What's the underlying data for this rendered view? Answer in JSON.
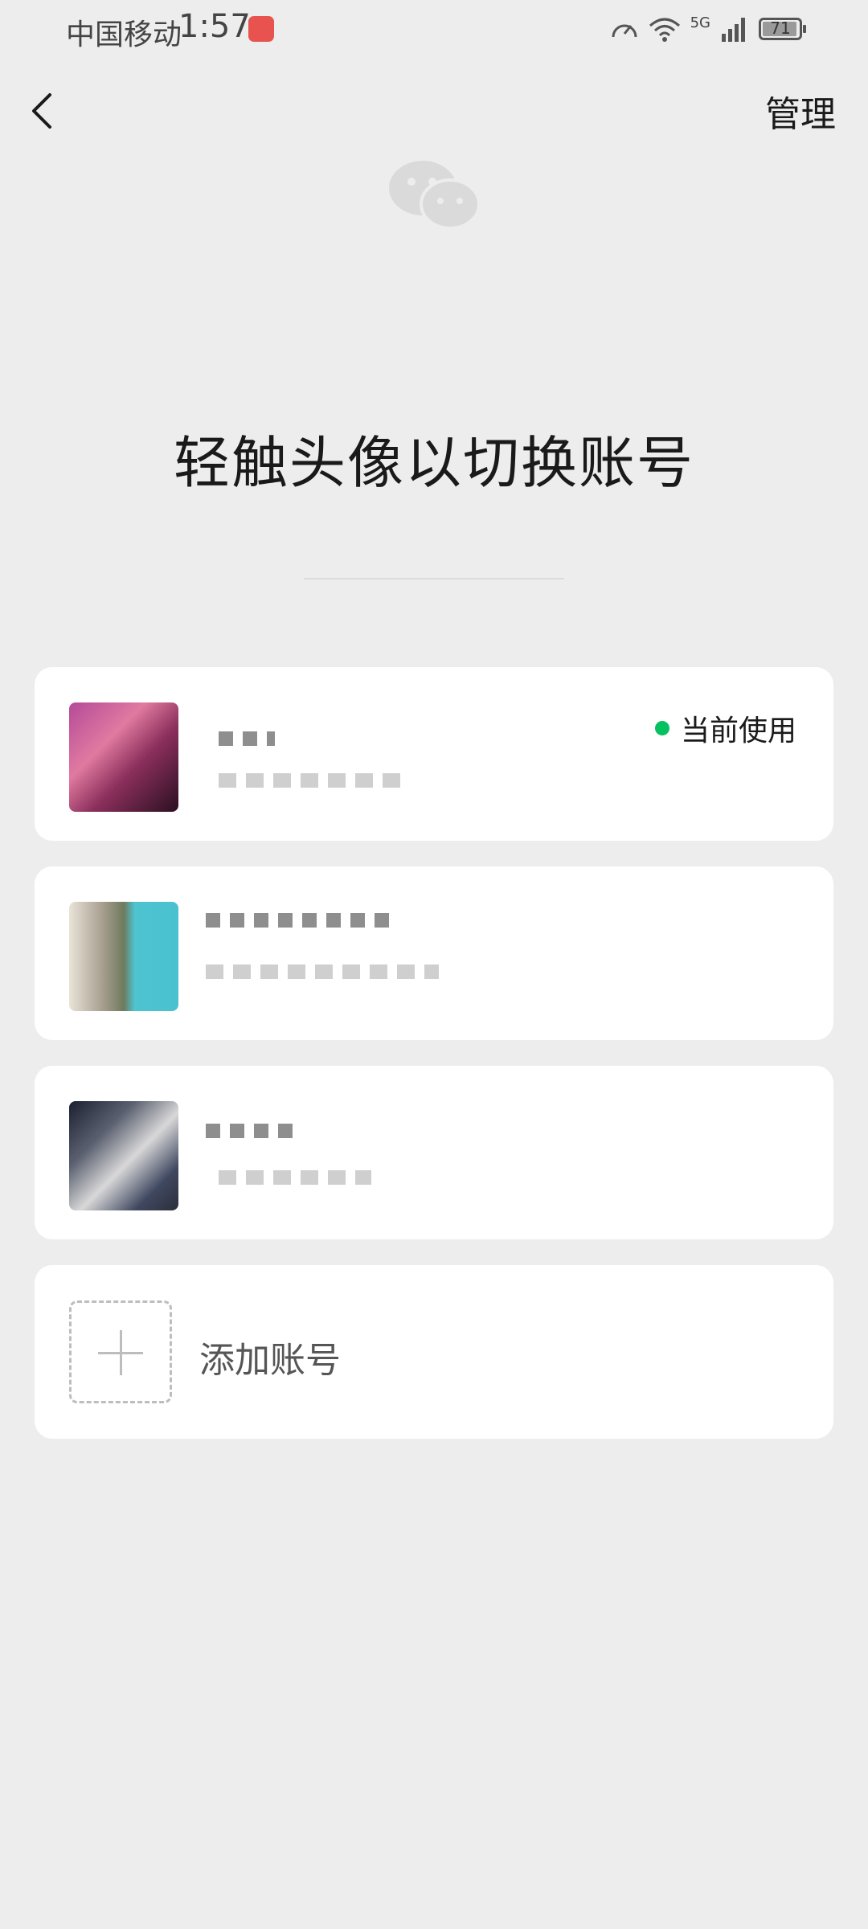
{
  "status_bar": {
    "carrier": "中国移动",
    "time": "1:57",
    "network": "5G",
    "battery": "71"
  },
  "header": {
    "manage_label": "管理"
  },
  "title": "轻触头像以切换账号",
  "accounts": [
    {
      "status_label": "当前使用",
      "status_color": "#07c160"
    },
    {},
    {}
  ],
  "add_account": {
    "label": "添加账号"
  }
}
